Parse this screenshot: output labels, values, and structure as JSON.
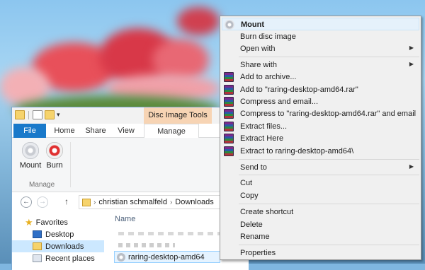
{
  "explorer": {
    "context_tab_header": "Disc Image Tools",
    "tabs": {
      "file": "File",
      "home": "Home",
      "share": "Share",
      "view": "View",
      "manage": "Manage"
    },
    "ribbon": {
      "mount_label": "Mount",
      "burn_label": "Burn",
      "group_label": "Manage"
    },
    "address": {
      "segment1": "christian schmalfeld",
      "segment2": "Downloads"
    },
    "nav_pane": {
      "favorites": "Favorites",
      "desktop": "Desktop",
      "downloads": "Downloads",
      "recent": "Recent places"
    },
    "content": {
      "column_name": "Name",
      "selected_file": "raring-desktop-amd64"
    }
  },
  "context_menu": {
    "mount": "Mount",
    "burn_disc_image": "Burn disc image",
    "open_with": "Open with",
    "share_with": "Share with",
    "add_to_archive": "Add to archive...",
    "add_to_rar": "Add to \"raring-desktop-amd64.rar\"",
    "compress_email": "Compress and email...",
    "compress_rar_email": "Compress to \"raring-desktop-amd64.rar\" and email",
    "extract_files": "Extract files...",
    "extract_here": "Extract Here",
    "extract_to": "Extract to raring-desktop-amd64\\",
    "send_to": "Send to",
    "cut": "Cut",
    "copy": "Copy",
    "create_shortcut": "Create shortcut",
    "delete": "Delete",
    "rename": "Rename",
    "properties": "Properties"
  },
  "icons": {
    "disc": "disc-icon",
    "winrar": "winrar-icon",
    "folder": "folder-icon",
    "star": "star-icon"
  },
  "colors": {
    "file_tab": "#1979ca",
    "context_tab": "#f7d4b4",
    "selection": "#cce8ff",
    "menu_highlight": "#e5f1fb"
  }
}
